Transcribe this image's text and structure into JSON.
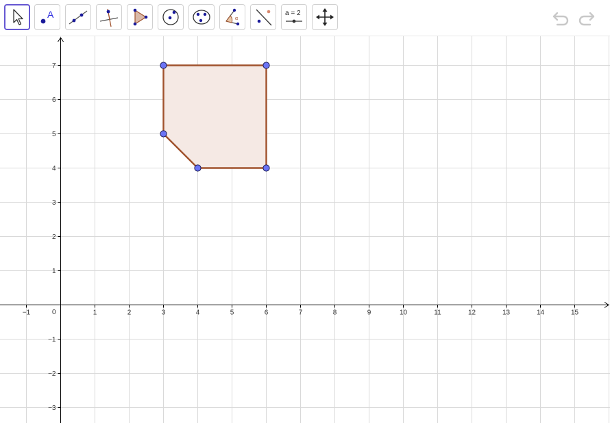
{
  "toolbar": {
    "tools": [
      {
        "name": "move-tool",
        "icon": "arrow-pointer-icon",
        "selected": true
      },
      {
        "name": "point-tool",
        "icon": "point-with-label-icon",
        "selected": false
      },
      {
        "name": "line-tool",
        "icon": "line-through-two-points-icon",
        "selected": false
      },
      {
        "name": "perpendicular-line-tool",
        "icon": "perpendicular-line-icon",
        "selected": false
      },
      {
        "name": "polygon-tool",
        "icon": "polygon-icon",
        "selected": false
      },
      {
        "name": "circle-tool",
        "icon": "circle-center-point-icon",
        "selected": false
      },
      {
        "name": "conic-tool",
        "icon": "ellipse-icon",
        "selected": false
      },
      {
        "name": "angle-tool",
        "icon": "angle-icon",
        "selected": false
      },
      {
        "name": "reflect-tool",
        "icon": "reflect-about-line-icon",
        "selected": false
      },
      {
        "name": "slider-tool",
        "icon": "slider-icon",
        "selected": false,
        "label": "a = 2"
      },
      {
        "name": "move-graphics-view-tool",
        "icon": "move-arrows-icon",
        "selected": false
      }
    ],
    "undo_icon": "undo-icon",
    "redo_icon": "redo-icon"
  },
  "graphics": {
    "x_ticks": [
      "−1",
      "1",
      "2",
      "3",
      "4",
      "5",
      "6",
      "7",
      "8",
      "9",
      "10",
      "11",
      "12",
      "13",
      "14",
      "15"
    ],
    "y_ticks": [
      "7",
      "6",
      "5",
      "4",
      "3",
      "2",
      "1",
      "−1",
      "−2",
      "−3"
    ],
    "origin_label": "0",
    "polygon": {
      "vertices": [
        [
          3,
          7
        ],
        [
          6,
          7
        ],
        [
          6,
          4
        ],
        [
          4,
          4
        ],
        [
          3,
          5
        ]
      ],
      "stroke_color": "#a0522d",
      "fill_color": "#f5e9e4"
    },
    "point_color": "#6b74f5",
    "grid_color": "#d9d9d9",
    "axis_color": "#000000"
  }
}
